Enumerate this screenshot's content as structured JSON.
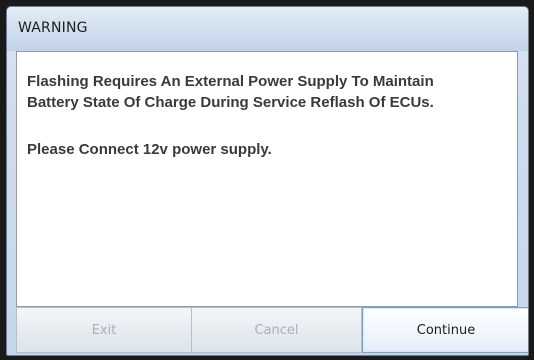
{
  "window": {
    "title": "WARNING"
  },
  "message": {
    "line1": "Flashing Requires An External Power Supply To Maintain",
    "line2": "Battery State Of Charge During Service Reflash Of ECUs.",
    "line3": "Please Connect 12v power supply."
  },
  "buttons": {
    "exit_label": "Exit",
    "cancel_label": "Cancel",
    "continue_label": "Continue"
  },
  "colors": {
    "titlebar": "#cfdcec",
    "disabled_text": "#a9b0b8",
    "default_button_border": "#7da2ce"
  }
}
